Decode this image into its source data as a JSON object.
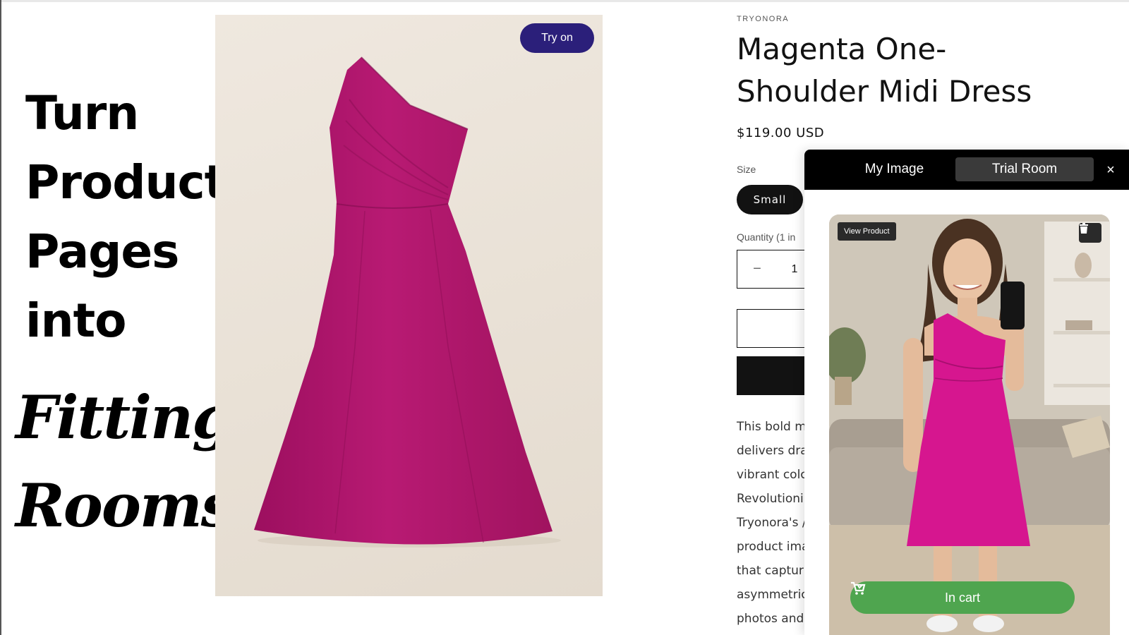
{
  "headline": {
    "lines": [
      "Turn",
      "Product",
      "Pages",
      "into"
    ],
    "accent": [
      "Fitting",
      "Rooms"
    ]
  },
  "product_image": {
    "try_on_label": "Try on"
  },
  "product": {
    "vendor": "TRYONORA",
    "title_line1": "Magenta One-",
    "title_line2": "Shoulder Midi Dress",
    "price": "$119.00 USD",
    "size_label": "Size",
    "selected_size": "Small",
    "quantity_label": "Quantity (1 in",
    "quantity_minus": "−",
    "quantity_value": "1",
    "description_lines": [
      "This bold m",
      "delivers dra",
      "vibrant colc",
      "Revolutioni",
      "Tryonora's /",
      "product ima",
      "that captur",
      "asymmetric",
      "photos and"
    ]
  },
  "widget": {
    "tab_my_image": "My Image",
    "tab_trial_room": "Trial Room",
    "close_label": "×",
    "view_product_label": "View Product",
    "in_cart_label": "In cart"
  },
  "colors": {
    "dress": "#b0176e",
    "try_on_button": "#2b1f7a",
    "in_cart_button": "#4fa54f",
    "widget_header": "#000000"
  }
}
